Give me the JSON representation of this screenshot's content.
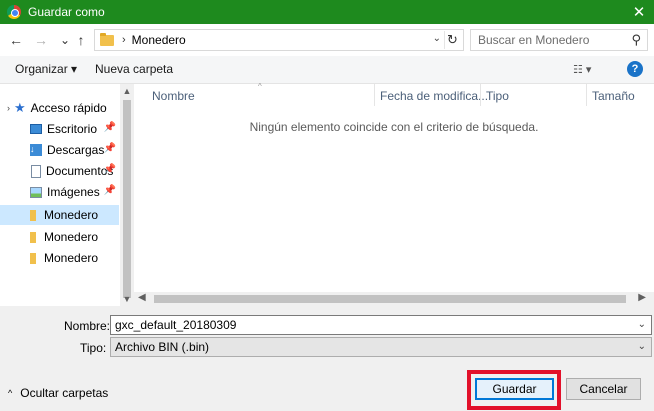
{
  "window": {
    "title": "Guardar como",
    "close_glyph": "✕"
  },
  "address": {
    "back_glyph": "←",
    "forward_glyph": "→",
    "recent_glyph": "⌄",
    "up_glyph": "↑",
    "separator_glyph": "›",
    "path": "Monedero",
    "dropdown_glyph": "⌄",
    "refresh_glyph": "↻"
  },
  "search": {
    "placeholder": "Buscar en Monedero",
    "icon_glyph": "⚲"
  },
  "toolbar": {
    "organize_label": "Organizar ▾",
    "new_folder_label": "Nueva carpeta",
    "view_glyph": "☷ ▾",
    "help_glyph": "?"
  },
  "nav": {
    "expand_glyph": "›",
    "quick_access_label": "Acceso rápido",
    "pin_glyph": "📌",
    "items": [
      {
        "label": "Escritorio",
        "icon": "desktop-icon",
        "pinned": true
      },
      {
        "label": "Descargas",
        "icon": "download-icon",
        "pinned": true
      },
      {
        "label": "Documentos",
        "icon": "document-icon",
        "pinned": true
      },
      {
        "label": "Imágenes",
        "icon": "pictures-icon",
        "pinned": true
      },
      {
        "label": "Monedero",
        "icon": "folder-icon",
        "selected": true
      },
      {
        "label": "Monedero",
        "icon": "folder-icon"
      },
      {
        "label": "Monedero",
        "icon": "folder-icon"
      }
    ],
    "download_arrow_glyph": "↓"
  },
  "scroll": {
    "up_glyph": "▲",
    "down_glyph": "▼",
    "left_glyph": "◀",
    "right_glyph": "▶"
  },
  "columns": {
    "name": "Nombre",
    "date": "Fecha de modifica...",
    "type": "Tipo",
    "size": "Tamaño",
    "sort_glyph": "^"
  },
  "empty_message": "Ningún elemento coincide con el criterio de búsqueda.",
  "form": {
    "name_label": "Nombre:",
    "name_value": "gxc_default_20180309",
    "type_label": "Tipo:",
    "type_value": "Archivo BIN (.bin)",
    "dropdown_glyph": "⌄"
  },
  "footer": {
    "hide_folders_label": "Ocultar carpetas",
    "hide_glyph": "^",
    "save_label": "Guardar",
    "cancel_label": "Cancelar"
  },
  "colors": {
    "titlebar": "#1e8a1e",
    "selection": "#cce8ff",
    "highlight": "#e2102a",
    "primary_border": "#0078d7"
  }
}
